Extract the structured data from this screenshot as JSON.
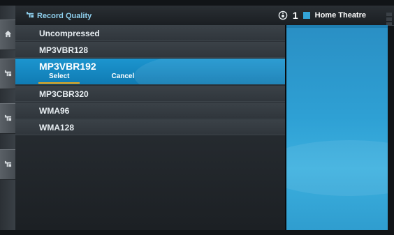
{
  "header": {
    "title": "Record Quality",
    "zone_number": "1",
    "zone_name": "Home Theatre",
    "zone_color": "#33a4d8",
    "title_icon": "record-quality-icon",
    "speaker_icon": "speaker-icon"
  },
  "rail": {
    "tabs": [
      {
        "icon": "home-icon"
      },
      {
        "icon": "media-icon"
      },
      {
        "icon": "media-icon"
      },
      {
        "icon": "media-icon"
      }
    ]
  },
  "list": {
    "items": [
      {
        "label": "Uncompressed"
      },
      {
        "label": "MP3VBR128"
      },
      {
        "label": "MP3VBR192"
      },
      {
        "label": "MP3CBR320"
      },
      {
        "label": "WMA96"
      },
      {
        "label": "WMA128"
      }
    ],
    "selected_index": 2,
    "selected_actions": {
      "select_label": "Select",
      "cancel_label": "Cancel"
    }
  },
  "colors": {
    "accent": "#1c95cf",
    "underline": "#f0a816",
    "title_text": "#8fd0ee"
  }
}
